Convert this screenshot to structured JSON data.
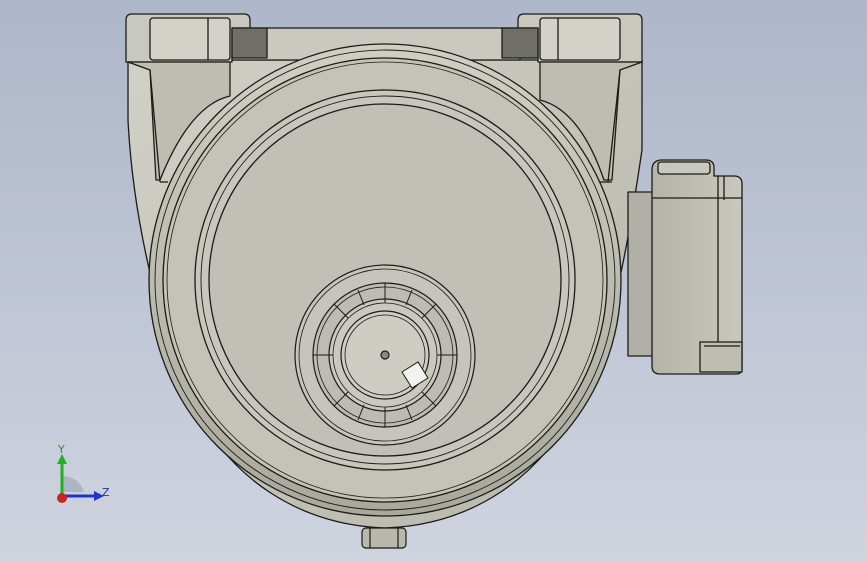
{
  "viewport": {
    "background_top": "#aeb6c9",
    "background_bottom": "#cfd4df",
    "part_color": "#c4c4b9",
    "edge_color": "#1b1b18"
  },
  "triad": {
    "y_label": "Y",
    "z_label": "Z",
    "y_color": "#22b022",
    "z_color": "#2233cc",
    "x_color": "#cc2222"
  }
}
